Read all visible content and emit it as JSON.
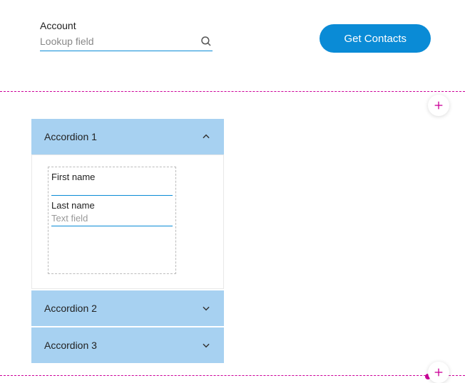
{
  "lookup": {
    "label": "Account",
    "placeholder": "Lookup field"
  },
  "actions": {
    "get_contacts": "Get Contacts"
  },
  "accordion": {
    "items": [
      {
        "title": "Accordion 1",
        "expanded": true
      },
      {
        "title": "Accordion 2",
        "expanded": false
      },
      {
        "title": "Accordion 3",
        "expanded": false
      }
    ]
  },
  "fields": {
    "first_name": {
      "label": "First name",
      "value": ""
    },
    "last_name": {
      "label": "Last name",
      "placeholder": "Text field"
    }
  },
  "colors": {
    "accent": "#0a8bd6",
    "magenta": "#cc0099",
    "panel": "#a7d1f1"
  }
}
